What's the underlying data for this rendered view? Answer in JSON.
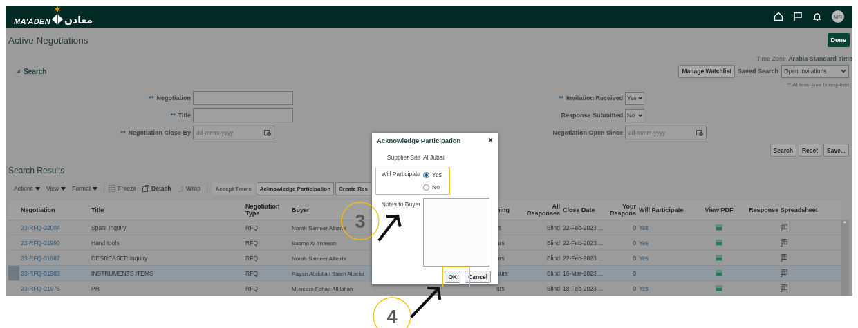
{
  "header": {
    "logo_text": "MA'ADEN",
    "logo_arabic": "معادن",
    "avatar": "MR"
  },
  "page": {
    "title": "Active Negotiations",
    "done_button": "Done",
    "time_zone_label": "Time Zone",
    "time_zone_value": "Arabia Standard Time"
  },
  "search": {
    "heading": "Search",
    "expanded": true,
    "manage_watchlist": "Manage Watchlist",
    "saved_search_label": "Saved Search",
    "saved_search_value": "Open Invitations",
    "required_note": "** At least one is required",
    "left_fields": [
      {
        "kind": "text",
        "label": "Negotiation",
        "required_mark": "**"
      },
      {
        "kind": "text",
        "label": "Title",
        "required_mark": "**"
      },
      {
        "kind": "date",
        "label": "Negotiation Close By",
        "required_mark": "**",
        "placeholder": "dd-mmm-yyyy"
      }
    ],
    "right_fields": [
      {
        "kind": "select",
        "label": "Invitation Received",
        "required_mark": "**",
        "value": "Yes"
      },
      {
        "kind": "select",
        "label": "Response Submitted",
        "value": "No"
      },
      {
        "kind": "date",
        "label": "Negotiation Open Since",
        "placeholder": "dd-mmm-yyyy"
      }
    ],
    "buttons": [
      "Search",
      "Reset",
      "Save..."
    ]
  },
  "results": {
    "heading": "Search Results",
    "menus": [
      "Actions",
      "View",
      "Format"
    ],
    "tools": [
      {
        "label": "Freeze",
        "disabled": true
      },
      {
        "label": "Detach",
        "disabled": false
      },
      {
        "label": "Wrap",
        "disabled": true
      }
    ],
    "buttons": [
      {
        "label": "Accept Terms",
        "disabled": true
      },
      {
        "label": "Acknowledge Participation",
        "disabled": false
      },
      {
        "label": "Create Res",
        "disabled": false
      }
    ],
    "columns": [
      "Negotiation",
      "Title",
      "Negotiation Type",
      "Buyer",
      "ning",
      "All Responses",
      "Close Date",
      "Your Respons",
      "Will Participate",
      "View PDF",
      "Response Spreadsheet"
    ],
    "rows": [
      {
        "selected": false,
        "negotiation": "23-RFQ-02004",
        "title": "Spare Inquiry",
        "type": "RFQ",
        "buyer": "Norah Sameer Alharbi",
        "column_5": "rs",
        "all_responses": "Blind",
        "close_date": "22-Feb-2023 ...",
        "your_responses": "0",
        "will_participate": "Yes"
      },
      {
        "selected": false,
        "negotiation": "23-RFQ-01990",
        "title": "Hand tools",
        "type": "RFQ",
        "buyer": "Basma Al Thawab",
        "column_5": "urs",
        "all_responses": "Blind",
        "close_date": "22-Feb-2023 ...",
        "your_responses": "0",
        "will_participate": "Yes"
      },
      {
        "selected": false,
        "negotiation": "23-RFQ-01987",
        "title": "DEGREASER Inquiry",
        "type": "RFQ",
        "buyer": "Norah Sameer Alharbi",
        "column_5": "urs",
        "all_responses": "Blind",
        "close_date": "22-Feb-2023 ...",
        "your_responses": "0",
        "will_participate": "Yes"
      },
      {
        "selected": true,
        "negotiation": "23-RFQ-01983",
        "title": "INSTRUMENTS ITEMS",
        "type": "RFQ",
        "buyer": "Rayan Abdullah Saleh Albelai",
        "column_5": "ours",
        "all_responses": "Blind",
        "close_date": "16-Mar-2023 ...",
        "your_responses": "0"
      },
      {
        "selected": false,
        "negotiation": "23-RFQ-01975",
        "title": "PR",
        "type": "RFQ",
        "buyer": "Muneera Fahad AlHatlan",
        "column_5": "urs",
        "all_responses": "Blind",
        "close_date": "18-Feb-2023 ...",
        "your_responses": "0",
        "will_participate": "Yes"
      }
    ]
  },
  "dialog": {
    "title": "Acknowledge Participation",
    "close": "×",
    "supplier_site_label": "Supplier Site",
    "supplier_site_value": "Al Jubail",
    "will_participate_label": "Will Participate",
    "options": [
      {
        "label": "Yes",
        "selected": true
      },
      {
        "label": "No",
        "selected": false
      }
    ],
    "notes_label": "Notes to Buyer",
    "buttons": [
      "OK",
      "Cancel"
    ]
  },
  "annotations": [
    "3",
    "4"
  ]
}
